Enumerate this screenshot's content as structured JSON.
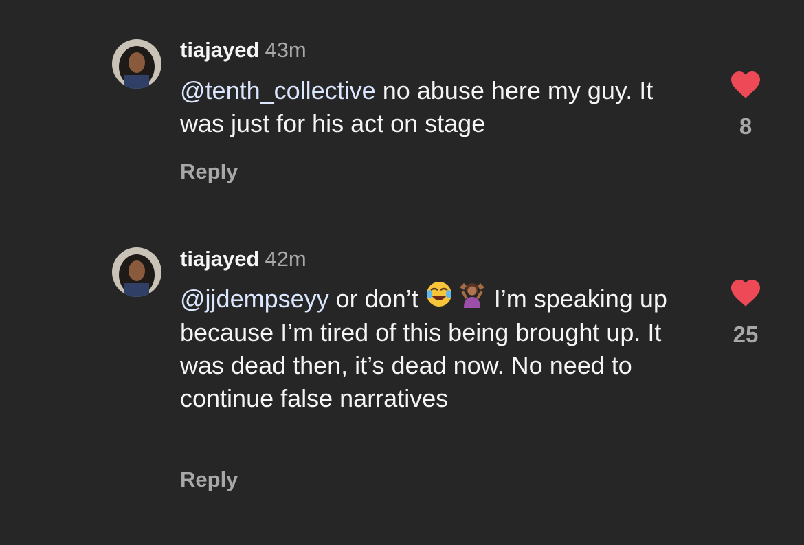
{
  "comments": [
    {
      "username": "tiajayed",
      "time": "43m",
      "mention": "@tenth_collective",
      "text_before_emoji": " no abuse here my guy. It was just for his act on stage",
      "text_after_emoji": "",
      "emojis": [],
      "likes": "8",
      "reply_label": "Reply",
      "heart_color": "#ed4956"
    },
    {
      "username": "tiajayed",
      "time": "42m",
      "mention": "@jjdempseyy",
      "text_before_emoji": " or don’t ",
      "text_after_emoji": " I’m speaking up because I’m tired of this being brought up. It was dead then, it’s dead now. No need to continue false narratives",
      "emojis": [
        "face-with-tears-of-joy-icon",
        "woman-shrugging-icon"
      ],
      "likes": "25",
      "reply_label": "Reply",
      "heart_color": "#ed4956"
    }
  ],
  "colors": {
    "background": "#262626",
    "primary_text": "#f5f5f5",
    "secondary_text": "#a8a8a8",
    "mention": "#dbe6ff",
    "like_heart": "#ed4956"
  }
}
